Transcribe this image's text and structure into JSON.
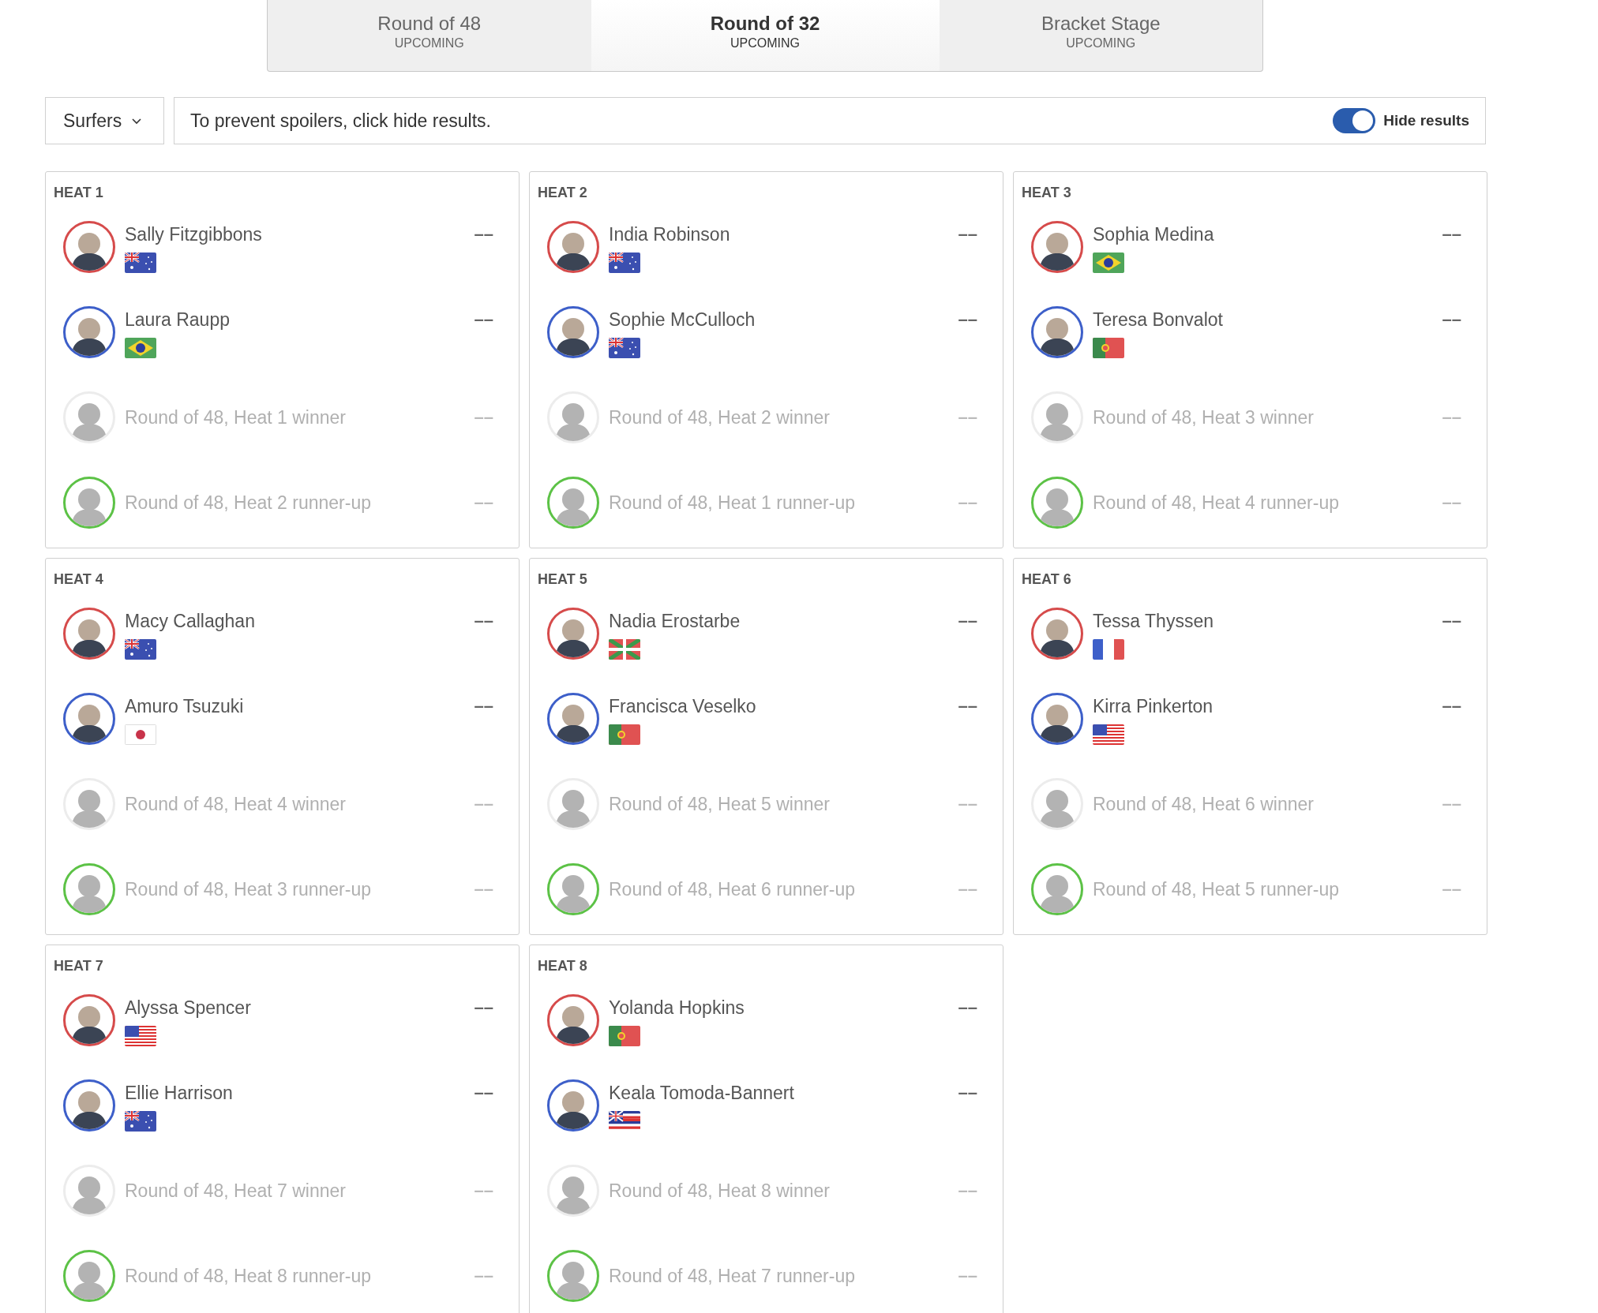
{
  "tabs": [
    {
      "label": "Round of 48",
      "status": "UPCOMING",
      "selected": false
    },
    {
      "label": "Round of 32",
      "status": "UPCOMING",
      "selected": true
    },
    {
      "label": "Bracket Stage",
      "status": "UPCOMING",
      "selected": false
    }
  ],
  "filter": {
    "label": "Surfers"
  },
  "notice": {
    "text": "To prevent spoilers, click hide results.",
    "toggle": {
      "label": "Hide results",
      "on": true
    }
  },
  "heats": [
    {
      "title": "HEAT 1",
      "surfers": [
        {
          "kind": "surfer",
          "name": "Sally Fitzgibbons",
          "flag": {
            "kind": "australia"
          },
          "color": "#d64b4b",
          "score": "––"
        },
        {
          "kind": "surfer",
          "name": "Laura Raupp",
          "flag": {
            "kind": "brazil"
          },
          "color": "#3d5fc9",
          "score": "––"
        },
        {
          "kind": "placeholder",
          "name": "Round of 48, Heat 1 winner",
          "color": "#ececec",
          "score": "––"
        },
        {
          "kind": "placeholder",
          "name": "Round of 48, Heat 2 runner-up",
          "color": "#5cc246",
          "score": "––"
        }
      ]
    },
    {
      "title": "HEAT 2",
      "surfers": [
        {
          "kind": "surfer",
          "name": "India Robinson",
          "flag": {
            "kind": "australia"
          },
          "color": "#d64b4b",
          "score": "––"
        },
        {
          "kind": "surfer",
          "name": "Sophie McCulloch",
          "flag": {
            "kind": "australia"
          },
          "color": "#3d5fc9",
          "score": "––"
        },
        {
          "kind": "placeholder",
          "name": "Round of 48, Heat 2 winner",
          "color": "#ececec",
          "score": "––"
        },
        {
          "kind": "placeholder",
          "name": "Round of 48, Heat 1 runner-up",
          "color": "#5cc246",
          "score": "––"
        }
      ]
    },
    {
      "title": "HEAT 3",
      "surfers": [
        {
          "kind": "surfer",
          "name": "Sophia Medina",
          "flag": {
            "kind": "brazil"
          },
          "color": "#d64b4b",
          "score": "––"
        },
        {
          "kind": "surfer",
          "name": "Teresa Bonvalot",
          "flag": {
            "kind": "portugal"
          },
          "color": "#3d5fc9",
          "score": "––"
        },
        {
          "kind": "placeholder",
          "name": "Round of 48, Heat 3 winner",
          "color": "#ececec",
          "score": "––"
        },
        {
          "kind": "placeholder",
          "name": "Round of 48, Heat 4 runner-up",
          "color": "#5cc246",
          "score": "––"
        }
      ]
    },
    {
      "title": "HEAT 4",
      "surfers": [
        {
          "kind": "surfer",
          "name": "Macy Callaghan",
          "flag": {
            "kind": "australia"
          },
          "color": "#d64b4b",
          "score": "––"
        },
        {
          "kind": "surfer",
          "name": "Amuro Tsuzuki",
          "flag": {
            "kind": "japan"
          },
          "color": "#3d5fc9",
          "score": "––"
        },
        {
          "kind": "placeholder",
          "name": "Round of 48, Heat 4 winner",
          "color": "#ececec",
          "score": "––"
        },
        {
          "kind": "placeholder",
          "name": "Round of 48, Heat 3 runner-up",
          "color": "#5cc246",
          "score": "––"
        }
      ]
    },
    {
      "title": "HEAT 5",
      "surfers": [
        {
          "kind": "surfer",
          "name": "Nadia Erostarbe",
          "flag": {
            "kind": "basque"
          },
          "color": "#d64b4b",
          "score": "––"
        },
        {
          "kind": "surfer",
          "name": "Francisca Veselko",
          "flag": {
            "kind": "portugal"
          },
          "color": "#3d5fc9",
          "score": "––"
        },
        {
          "kind": "placeholder",
          "name": "Round of 48, Heat 5 winner",
          "color": "#ececec",
          "score": "––"
        },
        {
          "kind": "placeholder",
          "name": "Round of 48, Heat 6 runner-up",
          "color": "#5cc246",
          "score": "––"
        }
      ]
    },
    {
      "title": "HEAT 6",
      "surfers": [
        {
          "kind": "surfer",
          "name": "Tessa Thyssen",
          "flag": {
            "kind": "france"
          },
          "color": "#d64b4b",
          "score": "––"
        },
        {
          "kind": "surfer",
          "name": "Kirra Pinkerton",
          "flag": {
            "kind": "usa"
          },
          "color": "#3d5fc9",
          "score": "––"
        },
        {
          "kind": "placeholder",
          "name": "Round of 48, Heat 6 winner",
          "color": "#ececec",
          "score": "––"
        },
        {
          "kind": "placeholder",
          "name": "Round of 48, Heat 5 runner-up",
          "color": "#5cc246",
          "score": "––"
        }
      ]
    },
    {
      "title": "HEAT 7",
      "surfers": [
        {
          "kind": "surfer",
          "name": "Alyssa Spencer",
          "flag": {
            "kind": "usa"
          },
          "color": "#d64b4b",
          "score": "––"
        },
        {
          "kind": "surfer",
          "name": "Ellie Harrison",
          "flag": {
            "kind": "australia"
          },
          "color": "#3d5fc9",
          "score": "––"
        },
        {
          "kind": "placeholder",
          "name": "Round of 48, Heat 7 winner",
          "color": "#ececec",
          "score": "––"
        },
        {
          "kind": "placeholder",
          "name": "Round of 48, Heat 8 runner-up",
          "color": "#5cc246",
          "score": "––"
        }
      ]
    },
    {
      "title": "HEAT 8",
      "surfers": [
        {
          "kind": "surfer",
          "name": "Yolanda Hopkins",
          "flag": {
            "kind": "portugal"
          },
          "color": "#d64b4b",
          "score": "––"
        },
        {
          "kind": "surfer",
          "name": "Keala Tomoda-Bannert",
          "flag": {
            "kind": "hawaii"
          },
          "color": "#3d5fc9",
          "score": "––"
        },
        {
          "kind": "placeholder",
          "name": "Round of 48, Heat 8 winner",
          "color": "#ececec",
          "score": "––"
        },
        {
          "kind": "placeholder",
          "name": "Round of 48, Heat 7 runner-up",
          "color": "#5cc246",
          "score": "––"
        }
      ]
    }
  ]
}
